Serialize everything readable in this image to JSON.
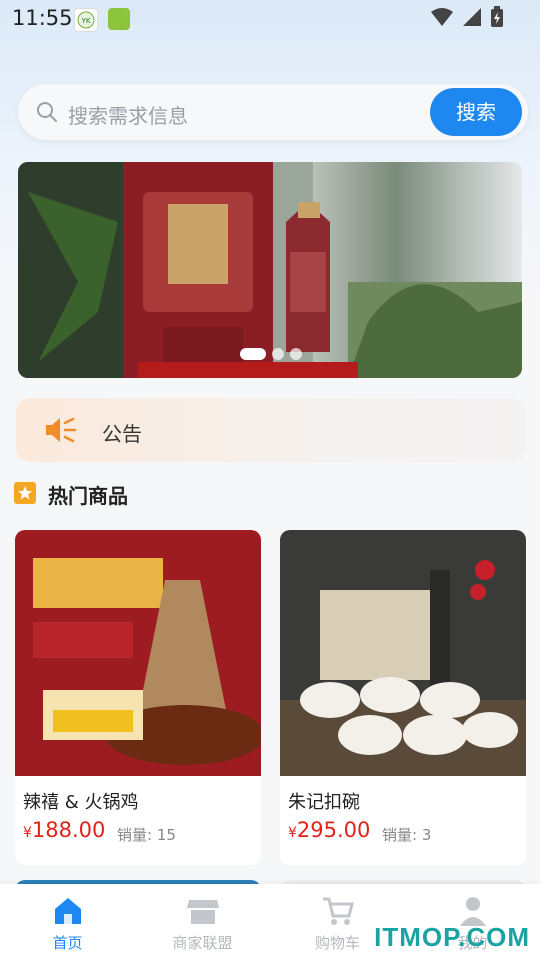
{
  "status_bar": {
    "time": "11:55",
    "app_icon_1": "YK",
    "app_icon_2": "app"
  },
  "search": {
    "placeholder": "搜索需求信息",
    "button_label": "搜索"
  },
  "banner": {
    "slides": 3,
    "active_index": 0
  },
  "notice": {
    "label": "公告"
  },
  "hot_section": {
    "title": "热门商品"
  },
  "products": [
    {
      "name": "辣禧 & 火锅鸡",
      "currency": "¥",
      "price": "188.00",
      "sales_label": "销量:",
      "sales": "15"
    },
    {
      "name": "朱记扣碗",
      "currency": "¥",
      "price": "295.00",
      "sales_label": "销量:",
      "sales": "3"
    }
  ],
  "tabs": [
    {
      "label": "首页",
      "icon": "home-icon",
      "active": true
    },
    {
      "label": "商家联盟",
      "icon": "store-icon",
      "active": false
    },
    {
      "label": "购物车",
      "icon": "cart-icon",
      "active": false
    },
    {
      "label": "我的",
      "icon": "user-icon",
      "active": false
    }
  ],
  "watermark": "ITMOP.COM",
  "colors": {
    "accent": "#1e88f0",
    "price": "#e2231a"
  }
}
